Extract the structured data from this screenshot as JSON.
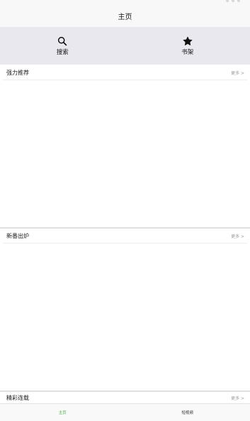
{
  "navbar": {
    "title": "主页"
  },
  "quick_actions": [
    {
      "label": "搜索",
      "icon": "search-icon"
    },
    {
      "label": "书架",
      "icon": "star-icon"
    }
  ],
  "sections": [
    {
      "title": "强力推荐",
      "more": "更多 >"
    },
    {
      "title": "新番出炉",
      "more": "更多 >"
    },
    {
      "title": "精彩连载",
      "more": "更多 >"
    }
  ],
  "tabbar": {
    "items": [
      {
        "label": "主页",
        "active": true
      },
      {
        "label": "短视频",
        "active": false
      }
    ],
    "active_color": "#3cb043"
  }
}
